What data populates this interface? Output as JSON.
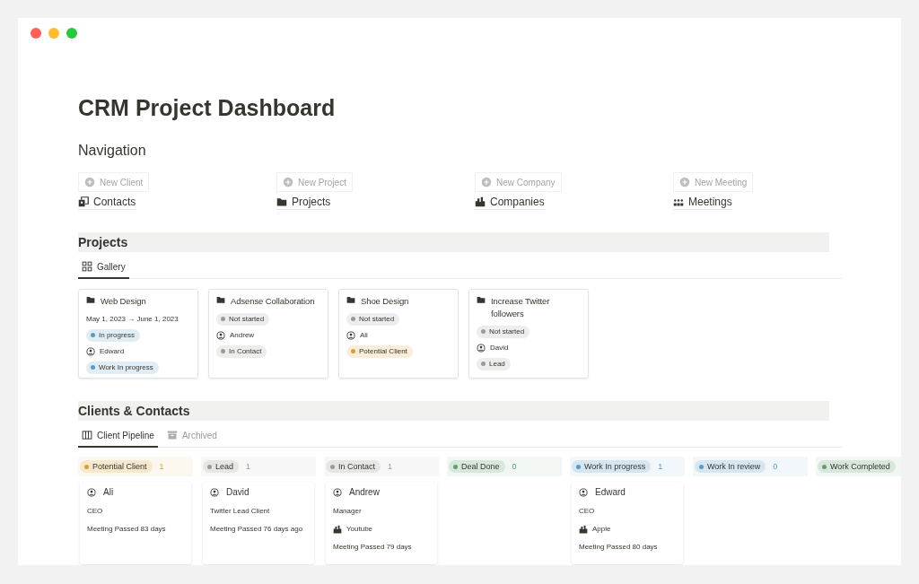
{
  "window": {
    "title": "CRM Project Dashboard"
  },
  "navigation": {
    "heading": "Navigation",
    "items": [
      {
        "kind": "contacts",
        "action": "New Client",
        "link": "Contacts"
      },
      {
        "kind": "folder",
        "action": "New Project",
        "link": "Projects"
      },
      {
        "kind": "buildings",
        "action": "New Company",
        "link": "Companies"
      },
      {
        "kind": "people",
        "action": "New Meeting",
        "link": "Meetings"
      }
    ]
  },
  "projects": {
    "heading": "Projects",
    "views": [
      {
        "kind": "gallery",
        "label": "Gallery",
        "selected": true
      }
    ],
    "cards": [
      {
        "title": "Web Design",
        "rows": [
          {
            "kind": "date",
            "text": "May 1, 2023 → June 1, 2023"
          },
          {
            "kind": "tag",
            "text": "In progress",
            "color": "#5a9ac8"
          },
          {
            "kind": "person",
            "text": "Edward"
          },
          {
            "kind": "tag",
            "text": "Work In progress",
            "color": "#5a9ac8"
          }
        ]
      },
      {
        "title": "Adsense Collaboration",
        "rows": [
          {
            "kind": "tag",
            "text": "Not started",
            "color": "#9b9a97"
          },
          {
            "kind": "person",
            "text": "Andrew"
          },
          {
            "kind": "tag",
            "text": "In Contact",
            "color": "#9b9a97"
          }
        ]
      },
      {
        "title": "Shoe Design",
        "rows": [
          {
            "kind": "tag",
            "text": "Not started",
            "color": "#9b9a97"
          },
          {
            "kind": "person",
            "text": "Ali"
          },
          {
            "kind": "tag",
            "text": "Potential Client",
            "color": "#d9a030"
          }
        ]
      },
      {
        "title": "Increase Twitter followers",
        "rows": [
          {
            "kind": "tag",
            "text": "Not started",
            "color": "#9b9a97"
          },
          {
            "kind": "person",
            "text": "David"
          },
          {
            "kind": "tag",
            "text": "Lead",
            "color": "#9b9a97"
          }
        ]
      }
    ]
  },
  "clients": {
    "heading": "Clients & Contacts",
    "views": [
      {
        "kind": "board",
        "label": "Client Pipeline",
        "selected": true
      },
      {
        "kind": "archive",
        "label": "Archived",
        "selected": false
      }
    ],
    "columns": [
      {
        "label": "Potential Client",
        "count": "1",
        "color": "#d9a030",
        "cards": [
          {
            "name": "Ali",
            "rows": [
              {
                "kind": "text",
                "text": "CEO"
              },
              {
                "kind": "text",
                "text": "Meeting Passed 83 days"
              }
            ]
          }
        ]
      },
      {
        "label": "Lead",
        "count": "1",
        "color": "#9b9a97",
        "cards": [
          {
            "name": "David",
            "rows": [
              {
                "kind": "text",
                "text": "Twitter Lead Client"
              },
              {
                "kind": "text",
                "text": "Meeting Passed 76 days ago"
              }
            ]
          }
        ]
      },
      {
        "label": "In Contact",
        "count": "1",
        "color": "#9b9a97",
        "cards": [
          {
            "name": "Andrew",
            "rows": [
              {
                "kind": "text",
                "text": "Manager"
              },
              {
                "kind": "company",
                "text": "Youtube"
              },
              {
                "kind": "text",
                "text": "Meeting Passed 79 days"
              }
            ]
          }
        ]
      },
      {
        "label": "Deal Done",
        "count": "0",
        "color": "#5e9e6e"
      },
      {
        "label": "Work In progress",
        "count": "1",
        "color": "#5a9ac8",
        "cards": [
          {
            "name": "Edward",
            "rows": [
              {
                "kind": "text",
                "text": "CEO"
              },
              {
                "kind": "company",
                "text": "Apple"
              },
              {
                "kind": "text",
                "text": "Meeting Passed 80 days"
              }
            ]
          }
        ]
      },
      {
        "label": "Work In review",
        "count": "0",
        "color": "#5a9ac8"
      },
      {
        "label": "Work Completed",
        "color": "#5e9e6e"
      }
    ]
  }
}
